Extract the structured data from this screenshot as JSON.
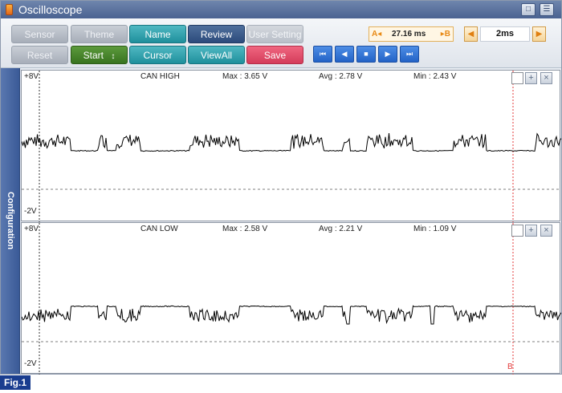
{
  "window": {
    "title": "Oscilloscope"
  },
  "toolbar": {
    "row1": [
      "Sensor",
      "Theme",
      "Name",
      "Review",
      "User Setting"
    ],
    "row2": [
      "Reset",
      "Start",
      "Cursor",
      "ViewAll",
      "Save"
    ],
    "start_arrows": "↕",
    "cursor_a_label": "A◂",
    "cursor_b_label": "▸B",
    "cursor_delta": "27.16 ms",
    "time_div": "2ms",
    "time_prev": "◀",
    "time_next": "▶",
    "playback": [
      "⏮",
      "◀",
      "■",
      "▶",
      "⏭"
    ]
  },
  "side_tab": {
    "label": "Configuration"
  },
  "channels": [
    {
      "name": "CAN HIGH",
      "max": "Max : 3.65 V",
      "avg": "Avg : 2.78 V",
      "min": "Min : 2.43 V",
      "scale_top": "+8V",
      "scale_bottom": "-2V",
      "trace_color": "#000000"
    },
    {
      "name": "CAN LOW",
      "max": "Max : 2.58 V",
      "avg": "Avg : 2.21 V",
      "min": "Min : 1.09 V",
      "scale_top": "+8V",
      "scale_bottom": "-2V",
      "trace_color": "#000000"
    }
  ],
  "cursor_b_marker": "B",
  "figure_label": "Fig.1",
  "colors": {
    "cursor_a": "#333333",
    "cursor_b": "#e33a3a",
    "accent": "#2c4b7c",
    "save": "#e24b68"
  }
}
